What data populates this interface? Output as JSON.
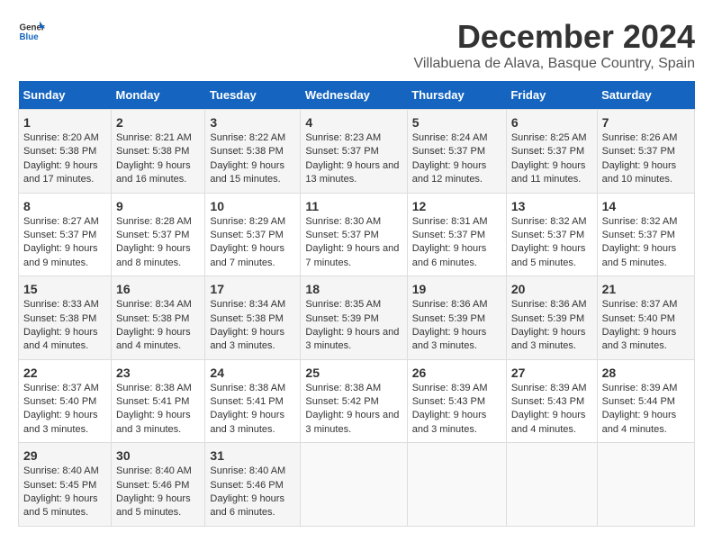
{
  "header": {
    "logo_line1": "General",
    "logo_line2": "Blue",
    "title": "December 2024",
    "subtitle": "Villabuena de Alava, Basque Country, Spain"
  },
  "calendar": {
    "days_of_week": [
      "Sunday",
      "Monday",
      "Tuesday",
      "Wednesday",
      "Thursday",
      "Friday",
      "Saturday"
    ],
    "weeks": [
      [
        {
          "day": "1",
          "sunrise": "8:20 AM",
          "sunset": "5:38 PM",
          "daylight": "9 hours and 17 minutes."
        },
        {
          "day": "2",
          "sunrise": "8:21 AM",
          "sunset": "5:38 PM",
          "daylight": "9 hours and 16 minutes."
        },
        {
          "day": "3",
          "sunrise": "8:22 AM",
          "sunset": "5:38 PM",
          "daylight": "9 hours and 15 minutes."
        },
        {
          "day": "4",
          "sunrise": "8:23 AM",
          "sunset": "5:37 PM",
          "daylight": "9 hours and 13 minutes."
        },
        {
          "day": "5",
          "sunrise": "8:24 AM",
          "sunset": "5:37 PM",
          "daylight": "9 hours and 12 minutes."
        },
        {
          "day": "6",
          "sunrise": "8:25 AM",
          "sunset": "5:37 PM",
          "daylight": "9 hours and 11 minutes."
        },
        {
          "day": "7",
          "sunrise": "8:26 AM",
          "sunset": "5:37 PM",
          "daylight": "9 hours and 10 minutes."
        }
      ],
      [
        {
          "day": "8",
          "sunrise": "8:27 AM",
          "sunset": "5:37 PM",
          "daylight": "9 hours and 9 minutes."
        },
        {
          "day": "9",
          "sunrise": "8:28 AM",
          "sunset": "5:37 PM",
          "daylight": "9 hours and 8 minutes."
        },
        {
          "day": "10",
          "sunrise": "8:29 AM",
          "sunset": "5:37 PM",
          "daylight": "9 hours and 7 minutes."
        },
        {
          "day": "11",
          "sunrise": "8:30 AM",
          "sunset": "5:37 PM",
          "daylight": "9 hours and 7 minutes."
        },
        {
          "day": "12",
          "sunrise": "8:31 AM",
          "sunset": "5:37 PM",
          "daylight": "9 hours and 6 minutes."
        },
        {
          "day": "13",
          "sunrise": "8:32 AM",
          "sunset": "5:37 PM",
          "daylight": "9 hours and 5 minutes."
        },
        {
          "day": "14",
          "sunrise": "8:32 AM",
          "sunset": "5:37 PM",
          "daylight": "9 hours and 5 minutes."
        }
      ],
      [
        {
          "day": "15",
          "sunrise": "8:33 AM",
          "sunset": "5:38 PM",
          "daylight": "9 hours and 4 minutes."
        },
        {
          "day": "16",
          "sunrise": "8:34 AM",
          "sunset": "5:38 PM",
          "daylight": "9 hours and 4 minutes."
        },
        {
          "day": "17",
          "sunrise": "8:34 AM",
          "sunset": "5:38 PM",
          "daylight": "9 hours and 3 minutes."
        },
        {
          "day": "18",
          "sunrise": "8:35 AM",
          "sunset": "5:39 PM",
          "daylight": "9 hours and 3 minutes."
        },
        {
          "day": "19",
          "sunrise": "8:36 AM",
          "sunset": "5:39 PM",
          "daylight": "9 hours and 3 minutes."
        },
        {
          "day": "20",
          "sunrise": "8:36 AM",
          "sunset": "5:39 PM",
          "daylight": "9 hours and 3 minutes."
        },
        {
          "day": "21",
          "sunrise": "8:37 AM",
          "sunset": "5:40 PM",
          "daylight": "9 hours and 3 minutes."
        }
      ],
      [
        {
          "day": "22",
          "sunrise": "8:37 AM",
          "sunset": "5:40 PM",
          "daylight": "9 hours and 3 minutes."
        },
        {
          "day": "23",
          "sunrise": "8:38 AM",
          "sunset": "5:41 PM",
          "daylight": "9 hours and 3 minutes."
        },
        {
          "day": "24",
          "sunrise": "8:38 AM",
          "sunset": "5:41 PM",
          "daylight": "9 hours and 3 minutes."
        },
        {
          "day": "25",
          "sunrise": "8:38 AM",
          "sunset": "5:42 PM",
          "daylight": "9 hours and 3 minutes."
        },
        {
          "day": "26",
          "sunrise": "8:39 AM",
          "sunset": "5:43 PM",
          "daylight": "9 hours and 3 minutes."
        },
        {
          "day": "27",
          "sunrise": "8:39 AM",
          "sunset": "5:43 PM",
          "daylight": "9 hours and 4 minutes."
        },
        {
          "day": "28",
          "sunrise": "8:39 AM",
          "sunset": "5:44 PM",
          "daylight": "9 hours and 4 minutes."
        }
      ],
      [
        {
          "day": "29",
          "sunrise": "8:40 AM",
          "sunset": "5:45 PM",
          "daylight": "9 hours and 5 minutes."
        },
        {
          "day": "30",
          "sunrise": "8:40 AM",
          "sunset": "5:46 PM",
          "daylight": "9 hours and 5 minutes."
        },
        {
          "day": "31",
          "sunrise": "8:40 AM",
          "sunset": "5:46 PM",
          "daylight": "9 hours and 6 minutes."
        },
        null,
        null,
        null,
        null
      ]
    ],
    "labels": {
      "sunrise": "Sunrise:",
      "sunset": "Sunset:",
      "daylight": "Daylight:"
    }
  }
}
